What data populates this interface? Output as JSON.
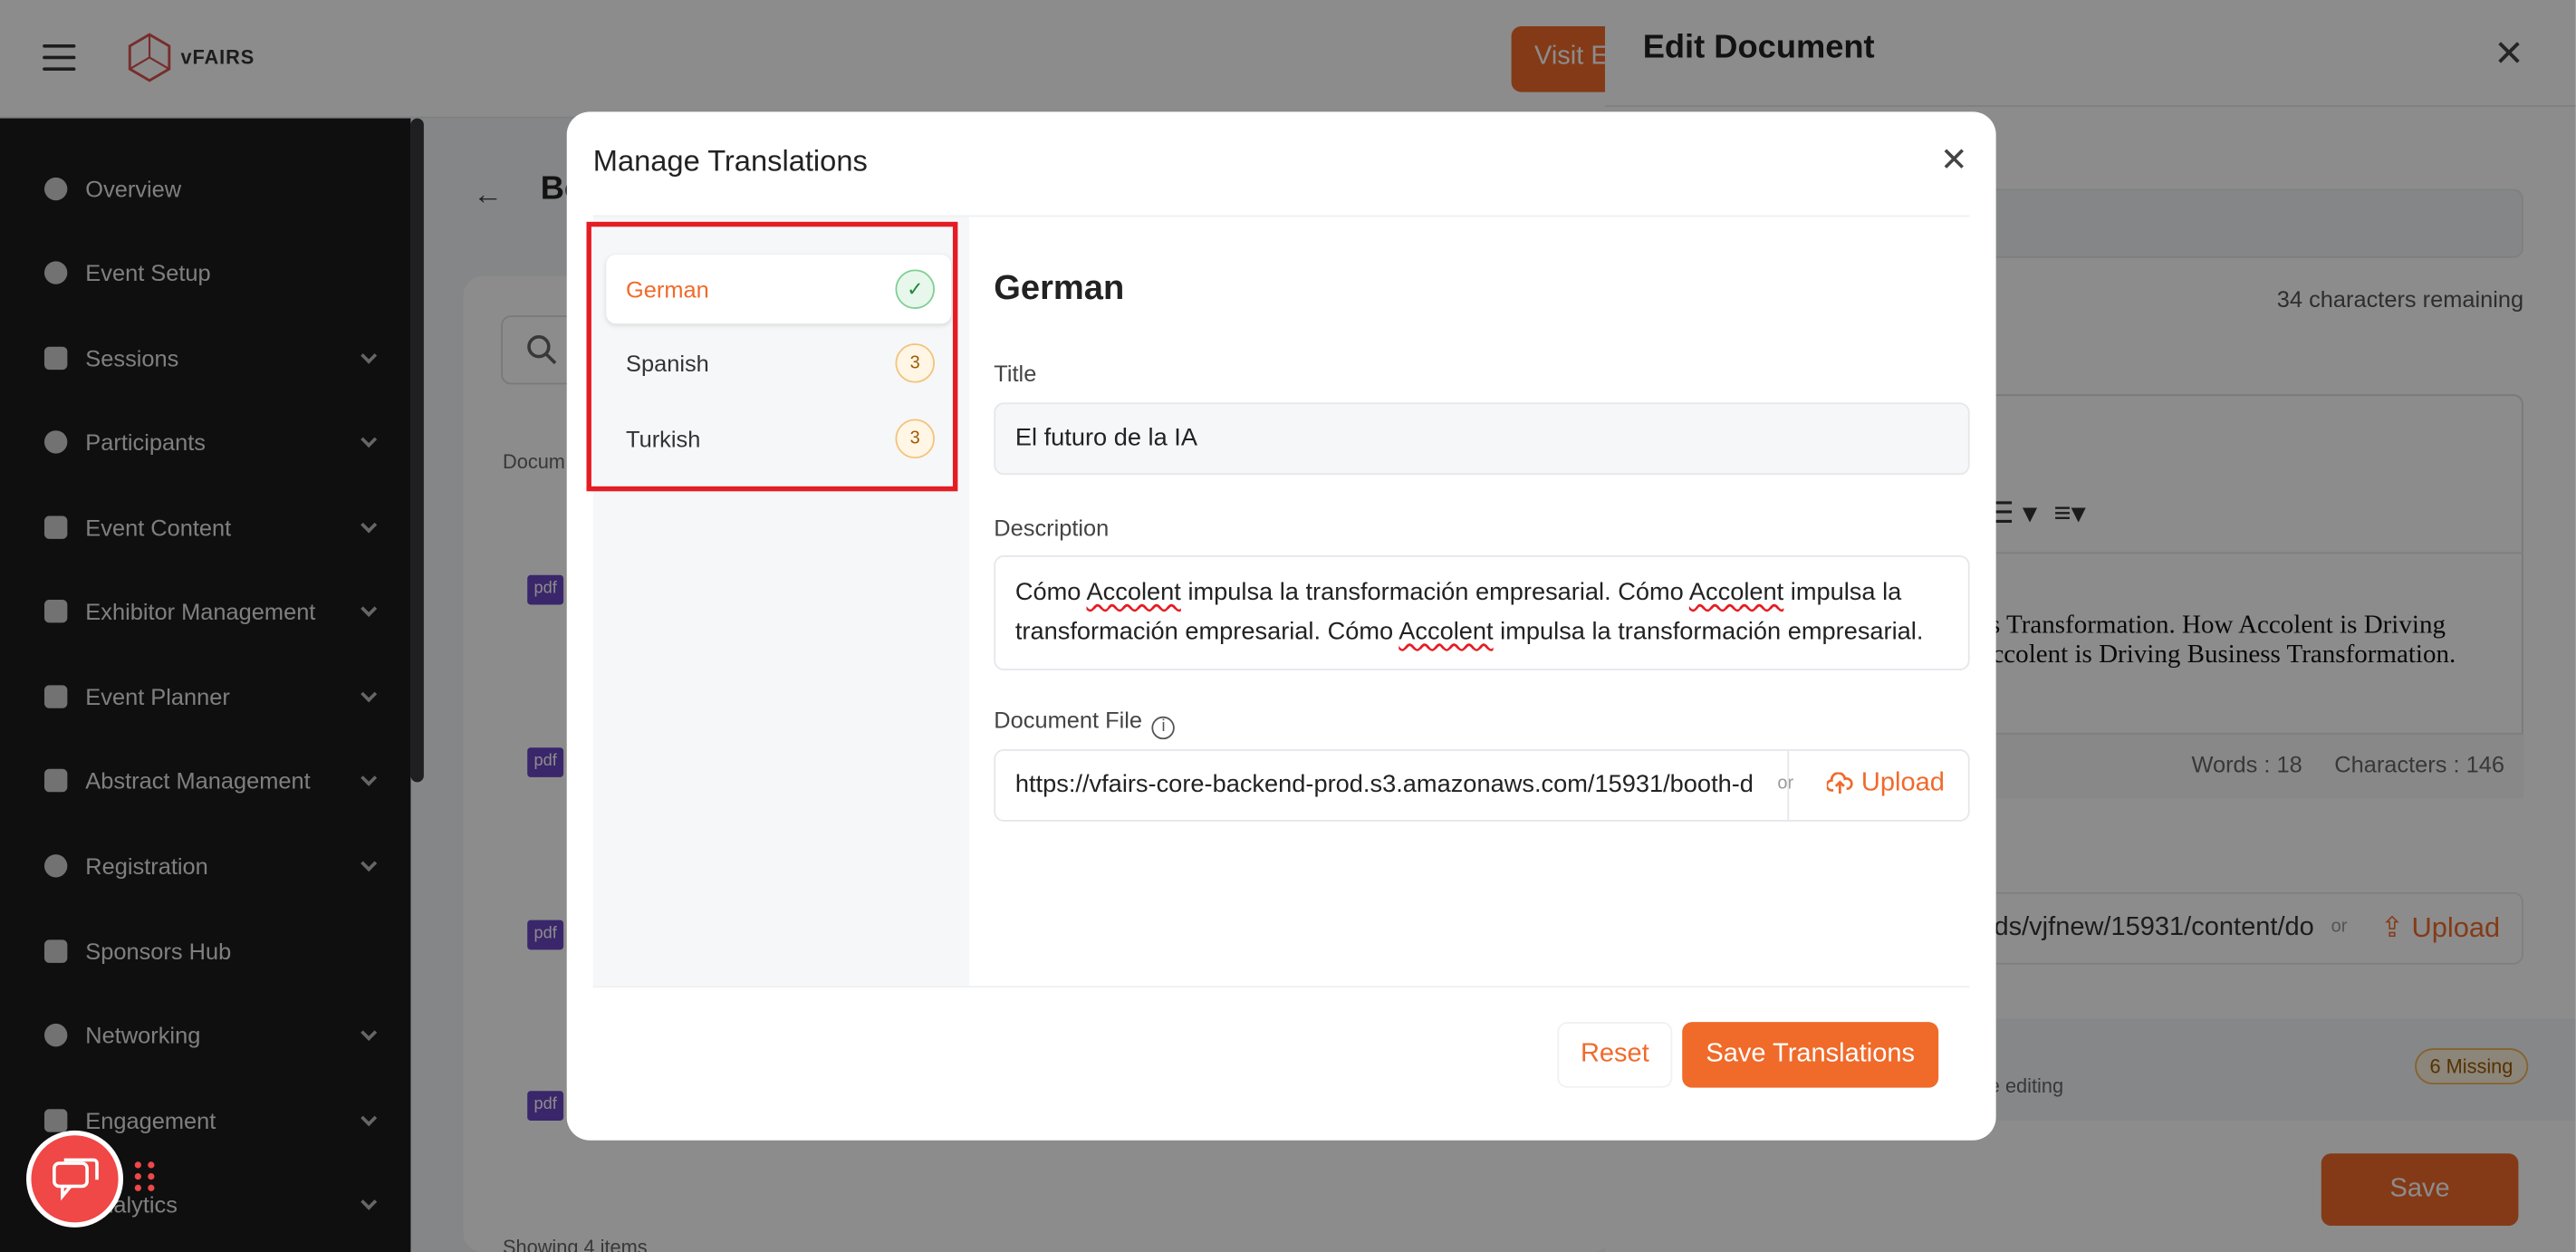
{
  "header": {
    "logo_text": "vFAIRS",
    "visit_button": "Visit E"
  },
  "sidebar": {
    "items": [
      {
        "label": "Overview"
      },
      {
        "label": "Event Setup"
      },
      {
        "label": "Sessions"
      },
      {
        "label": "Participants"
      },
      {
        "label": "Event Content"
      },
      {
        "label": "Exhibitor Management"
      },
      {
        "label": "Event Planner"
      },
      {
        "label": "Abstract Management"
      },
      {
        "label": "Registration"
      },
      {
        "label": "Sponsors Hub"
      },
      {
        "label": "Networking"
      },
      {
        "label": "Engagement"
      },
      {
        "label": "Analytics"
      }
    ]
  },
  "main": {
    "title": "Bo",
    "column_header": "Docum",
    "file_badge": "pdf",
    "showing": "Showing 4 items"
  },
  "drawer": {
    "title": "Edit Document",
    "chars_remaining": "34 characters remaining",
    "editor_line1": "ness Transformation. How Accolent is Driving",
    "editor_line2": "y Accolent is Driving Business Transformation.",
    "words": "Words : 18",
    "characters": "Characters : 146",
    "file_url": "oads/vjfnew/15931/content/do",
    "or": "or",
    "upload": "Upload",
    "missing_text": "while editing",
    "missing_badge": "6 Missing",
    "save": "Save"
  },
  "modal": {
    "title": "Manage Translations",
    "languages": [
      {
        "name": "German",
        "status": "✓"
      },
      {
        "name": "Spanish",
        "status": "3"
      },
      {
        "name": "Turkish",
        "status": "3"
      }
    ],
    "selected_language": "German",
    "title_label": "Title",
    "title_value": "El futuro de la IA",
    "description_label": "Description",
    "description": {
      "l1a": "Cómo ",
      "w1": "Accolent",
      "l1b": " impulsa la transformación empresarial. Cómo ",
      "w2": "Accolent",
      "l1c": " impulsa la",
      "l2a": "transformación empresarial. Cómo ",
      "w3": "Accolent",
      "l2b": " impulsa la transformación empresarial."
    },
    "file_label": "Document File",
    "file_url": "https://vfairs-core-backend-prod.s3.amazonaws.com/15931/booth-d",
    "or": "or",
    "upload": "Upload",
    "reset": "Reset",
    "save": "Save Translations"
  },
  "colors": {
    "accent": "#f06a2a",
    "highlight": "#e51c23",
    "sidebar_bg": "#1c1c1e",
    "chat_fab": "#f04747"
  },
  "icons": [
    "hamburger-icon",
    "vfairs-logo-icon",
    "info-icon",
    "gear-icon",
    "grid-icon",
    "users-icon",
    "document-icon",
    "calendar-icon",
    "share-icon",
    "flag-icon",
    "chart-icon",
    "close-icon",
    "check-icon",
    "upload-icon",
    "chat-icon",
    "back-arrow-icon",
    "search-icon"
  ]
}
